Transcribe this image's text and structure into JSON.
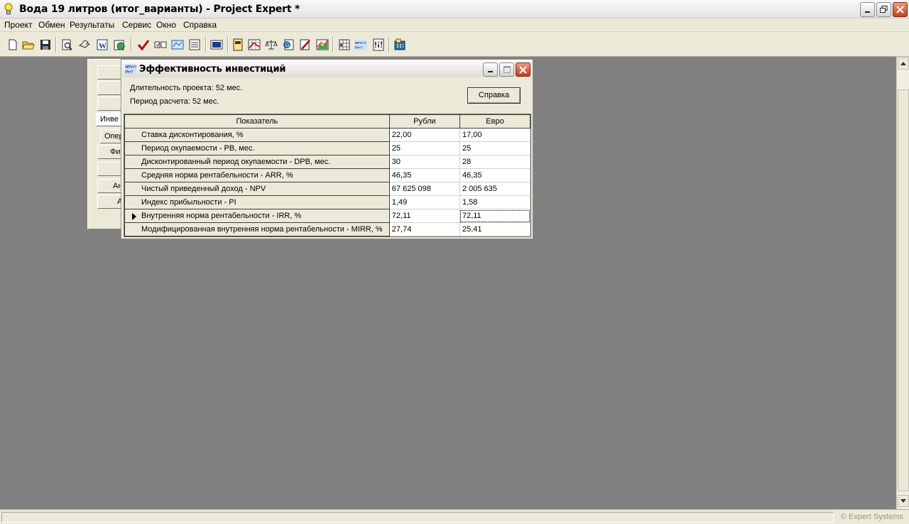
{
  "window": {
    "title": "Вода 19 литров (итог_варианты) - Project Expert *"
  },
  "menu": [
    "Проект",
    "Обмен",
    "Результаты",
    "Сервис",
    "Окно",
    "Справка"
  ],
  "toolbar_icons": [
    "new-file-icon",
    "open-folder-icon",
    "save-icon",
    "print-preview-icon",
    "print-icon",
    "word-export-icon",
    "web-icon",
    "check-icon",
    "compare-icon",
    "map-icon",
    "list-icon",
    "display-icon",
    "table-icon",
    "cash-flow-icon",
    "balance-icon",
    "report-icon",
    "pencil-icon",
    "chart-icon",
    "grid-icon",
    "npv-pi-icon",
    "settings-icon",
    "calculator-icon"
  ],
  "background_panel": {
    "buttons": [
      "",
      "",
      "",
      "Инве",
      "Опер",
      "Фи",
      "",
      "Ан",
      "А"
    ]
  },
  "dialog": {
    "title": "Эффективность инвестиций",
    "duration": "Длительность проекта: 52 мес.",
    "period": "Период расчета: 52 мес.",
    "help_label": "Справка",
    "columns": [
      "Показатель",
      "Рубли",
      "Евро"
    ],
    "rows": [
      {
        "label": "Ставка дисконтирования, %",
        "rub": "22,00",
        "eur": "17,00"
      },
      {
        "label": "Период окупаемости - PB, мес.",
        "rub": "25",
        "eur": "25"
      },
      {
        "label": "Дисконтированный период окупаемости - DPB, мес.",
        "rub": "30",
        "eur": "28"
      },
      {
        "label": "Средняя норма рентабельности - ARR, %",
        "rub": "46,35",
        "eur": "46,35"
      },
      {
        "label": "Чистый приведенный доход - NPV",
        "rub": "67 625 098",
        "eur": "2 005 635"
      },
      {
        "label": "Индекс прибыльности - PI",
        "rub": "1,49",
        "eur": "1,58"
      },
      {
        "label": "Внутренняя норма рентабельности - IRR, %",
        "rub": "72,11",
        "eur": "72,11"
      },
      {
        "label": "Модифицированная внутренняя норма рентабельности - MIRR, %",
        "rub": "27,74",
        "eur": "25,41"
      }
    ],
    "selected_row": 6
  },
  "status": {
    "credit": "© Expert Systems"
  }
}
